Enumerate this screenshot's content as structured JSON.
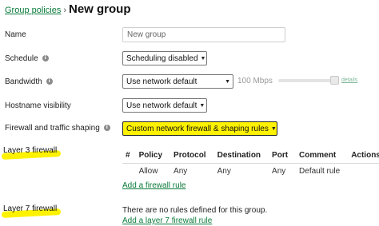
{
  "breadcrumb": {
    "parent": "Group policies",
    "separator": "›",
    "title": "New group"
  },
  "fields": {
    "name": {
      "label": "Name",
      "value": "New group"
    },
    "schedule": {
      "label": "Schedule",
      "value": "Scheduling disabled"
    },
    "bandwidth": {
      "label": "Bandwidth",
      "value": "Use network default",
      "limit_text": "100 Mbps",
      "details_link": "details"
    },
    "hostname_visibility": {
      "label": "Hostname visibility",
      "value": "Use network default"
    },
    "firewall": {
      "label": "Firewall and traffic shaping",
      "value": "Custom network firewall & shaping rules"
    }
  },
  "layer3": {
    "label": "Layer 3 firewall",
    "columns": [
      "#",
      "Policy",
      "Protocol",
      "Destination",
      "Port",
      "Comment",
      "Actions"
    ],
    "rows": [
      [
        "",
        "Allow",
        "Any",
        "Any",
        "Any",
        "Default rule",
        ""
      ]
    ],
    "add_link": "Add a firewall rule"
  },
  "layer7": {
    "label": "Layer 7 firewall",
    "empty_text": "There are no rules defined for this group.",
    "add_link": "Add a layer 7 firewall rule"
  },
  "colors": {
    "link": "#0a7a3a",
    "highlight": "#fff200"
  },
  "icons": {
    "info": "info-icon",
    "dropdown": "chevron-down-icon"
  }
}
